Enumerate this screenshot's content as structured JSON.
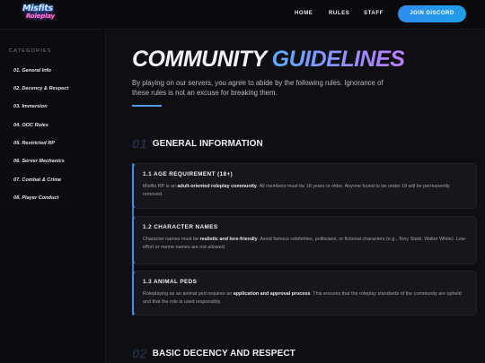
{
  "header": {
    "logo_line1": "Misfits",
    "logo_line2": "Roleplay",
    "nav": [
      "HOME",
      "RULES",
      "STAFF"
    ],
    "cta_label": "JOIN DISCORD"
  },
  "sidebar": {
    "title": "CATEGORIES",
    "items": [
      "01. General Info",
      "02. Decency & Respect",
      "03. Immersion",
      "04. OOC Rules",
      "05. Restricted RP",
      "06. Server Mechanics",
      "07. Combat & Crime",
      "08. Player Conduct"
    ]
  },
  "page": {
    "title_part1": "COMMUNITY",
    "title_part2": "GUIDELINES",
    "intro": "By playing on our servers, you agree to abide by the following rules. Ignorance of these rules is not an excuse for breaking them.",
    "accent_color": "#3b8ff0"
  },
  "sections": [
    {
      "num": "01",
      "title": "GENERAL INFORMATION"
    },
    {
      "num": "02",
      "title": "BASIC DECENCY AND RESPECT"
    }
  ],
  "rules": [
    {
      "title": "1.1 AGE REQUIREMENT (18+)",
      "pre": "Misfits RP is an ",
      "bold": "adult-oriented roleplay community",
      "post": ". All members must be 18 years or older. Anyone found to be under 18 will be permanently removed."
    },
    {
      "title": "1.2 CHARACTER NAMES",
      "pre": "Character names must be ",
      "bold": "realistic and lore-friendly",
      "post": ". Avoid famous celebrities, politicians, or fictional characters (e.g., Tony Stark, Walter White). Low-effort or meme names are not allowed."
    },
    {
      "title": "1.3 ANIMAL PEDS",
      "pre": "Roleplaying as an animal ped requires an ",
      "bold": "application and approval process",
      "post": ". This ensures that the roleplay standards of the community are upheld and that the role is used responsibly."
    }
  ]
}
